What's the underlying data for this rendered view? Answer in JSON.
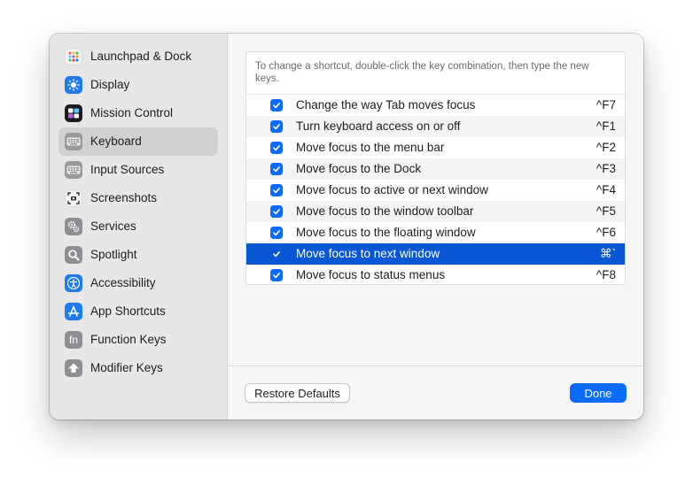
{
  "sidebar": {
    "items": [
      {
        "label": "Launchpad & Dock",
        "icon": "launchpad-icon",
        "color": "#f2f2f2"
      },
      {
        "label": "Display",
        "icon": "display-brightness-icon",
        "color": "#1e7cf0"
      },
      {
        "label": "Mission Control",
        "icon": "mission-control-icon",
        "color": "#1c1c1e"
      },
      {
        "label": "Keyboard",
        "icon": "keyboard-icon",
        "color": "#9a9a9a",
        "selected": true
      },
      {
        "label": "Input Sources",
        "icon": "keyboard-icon",
        "color": "#9a9a9a"
      },
      {
        "label": "Screenshots",
        "icon": "screenshot-icon",
        "color": "#f2f2f2"
      },
      {
        "label": "Services",
        "icon": "gears-icon",
        "color": "#8e8e93"
      },
      {
        "label": "Spotlight",
        "icon": "magnifier-icon",
        "color": "#8e8e93"
      },
      {
        "label": "Accessibility",
        "icon": "accessibility-icon",
        "color": "#1e7cf0"
      },
      {
        "label": "App Shortcuts",
        "icon": "app-store-icon",
        "color": "#1e7cf0"
      },
      {
        "label": "Function Keys",
        "icon": "fn-key-icon",
        "color": "#8e8e93"
      },
      {
        "label": "Modifier Keys",
        "icon": "up-arrow-icon",
        "color": "#8e8e93"
      }
    ]
  },
  "main": {
    "hint": "To change a shortcut, double-click the key combination, then type the new keys.",
    "shortcuts": [
      {
        "label": "Change the way Tab moves focus",
        "key": "^F7",
        "checked": true
      },
      {
        "label": "Turn keyboard access on or off",
        "key": "^F1",
        "checked": true
      },
      {
        "label": "Move focus to the menu bar",
        "key": "^F2",
        "checked": true
      },
      {
        "label": "Move focus to the Dock",
        "key": "^F3",
        "checked": true
      },
      {
        "label": "Move focus to active or next window",
        "key": "^F4",
        "checked": true
      },
      {
        "label": "Move focus to the window toolbar",
        "key": "^F5",
        "checked": true
      },
      {
        "label": "Move focus to the floating window",
        "key": "^F6",
        "checked": true
      },
      {
        "label": "Move focus to next window",
        "key": "⌘`",
        "checked": true,
        "selected": true
      },
      {
        "label": "Move focus to status menus",
        "key": "^F8",
        "checked": true
      }
    ]
  },
  "footer": {
    "restore_label": "Restore Defaults",
    "done_label": "Done"
  },
  "colors": {
    "accent": "#0a6cff",
    "selection": "#0a57d6"
  }
}
